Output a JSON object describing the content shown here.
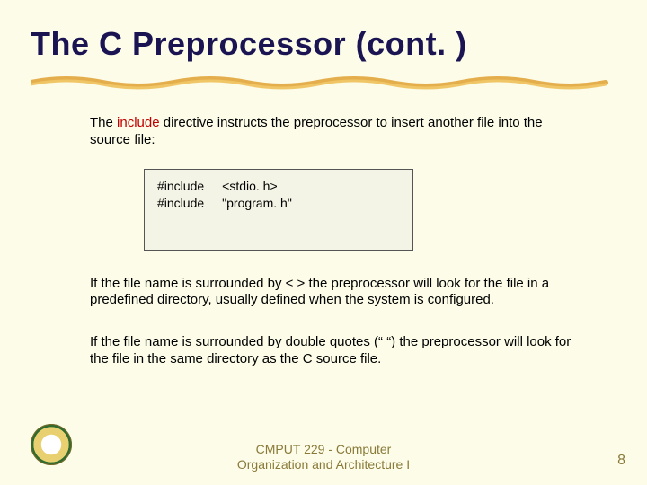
{
  "title": "The C Preprocessor (cont. )",
  "intro_prefix": "The ",
  "intro_keyword": "include",
  "intro_suffix": " directive instructs the preprocessor to insert another file into the source file:",
  "code": {
    "rows": [
      {
        "directive": "#include",
        "arg": "<stdio. h>"
      },
      {
        "directive": "#include",
        "arg": "\"program. h\""
      }
    ]
  },
  "para_angle": "If the file name is surrounded by < > the preprocessor will look for the file in a predefined directory, usually defined when the system is configured.",
  "para_quotes": "If the file name is surrounded by double quotes (“ “) the preprocessor will look for the file in the same directory as the C source file.",
  "footer_line1": "CMPUT 229 - Computer",
  "footer_line2": "Organization and Architecture I",
  "page_number": "8"
}
